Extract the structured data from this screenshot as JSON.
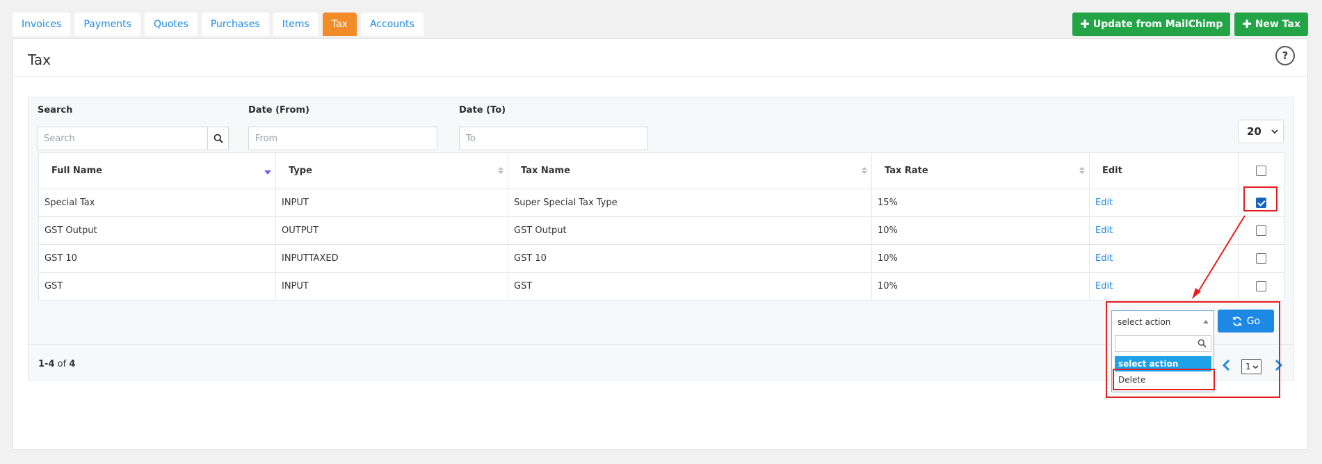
{
  "tabs": [
    "Invoices",
    "Payments",
    "Quotes",
    "Purchases",
    "Items",
    "Tax",
    "Accounts"
  ],
  "active_tab": "Tax",
  "actions": {
    "update_mailchimp": "Update from MailChimp",
    "new_tax": "New Tax"
  },
  "page": {
    "title": "Tax",
    "help": "?"
  },
  "filters": {
    "search_label": "Search",
    "search_placeholder": "Search",
    "date_from_label": "Date (From)",
    "date_from_placeholder": "From",
    "date_to_label": "Date (To)",
    "date_to_placeholder": "To",
    "per_page": "20"
  },
  "table": {
    "columns": [
      "Full Name",
      "Type",
      "Tax Name",
      "Tax Rate",
      "Edit"
    ],
    "rows": [
      {
        "full_name": "Special Tax",
        "type": "INPUT",
        "tax_name": "Super Special Tax Type",
        "tax_rate": "15%",
        "edit": "Edit",
        "checked": true
      },
      {
        "full_name": "GST Output",
        "type": "OUTPUT",
        "tax_name": "GST Output",
        "tax_rate": "10%",
        "edit": "Edit",
        "checked": false
      },
      {
        "full_name": "GST 10",
        "type": "INPUTTAXED",
        "tax_name": "GST 10",
        "tax_rate": "10%",
        "edit": "Edit",
        "checked": false
      },
      {
        "full_name": "GST",
        "type": "INPUT",
        "tax_name": "GST",
        "tax_rate": "10%",
        "edit": "Edit",
        "checked": false
      }
    ]
  },
  "bulk": {
    "selected": "select action",
    "options": [
      "select action",
      "Delete"
    ],
    "go_label": "Go"
  },
  "pagination": {
    "range": "1-4",
    "of_word": "of",
    "total": "4",
    "current_page": "1"
  },
  "colors": {
    "active_tab": "#f28c28",
    "green_button": "#23a547",
    "primary_blue": "#1e88e5",
    "annotation_red": "#e41e1e"
  }
}
